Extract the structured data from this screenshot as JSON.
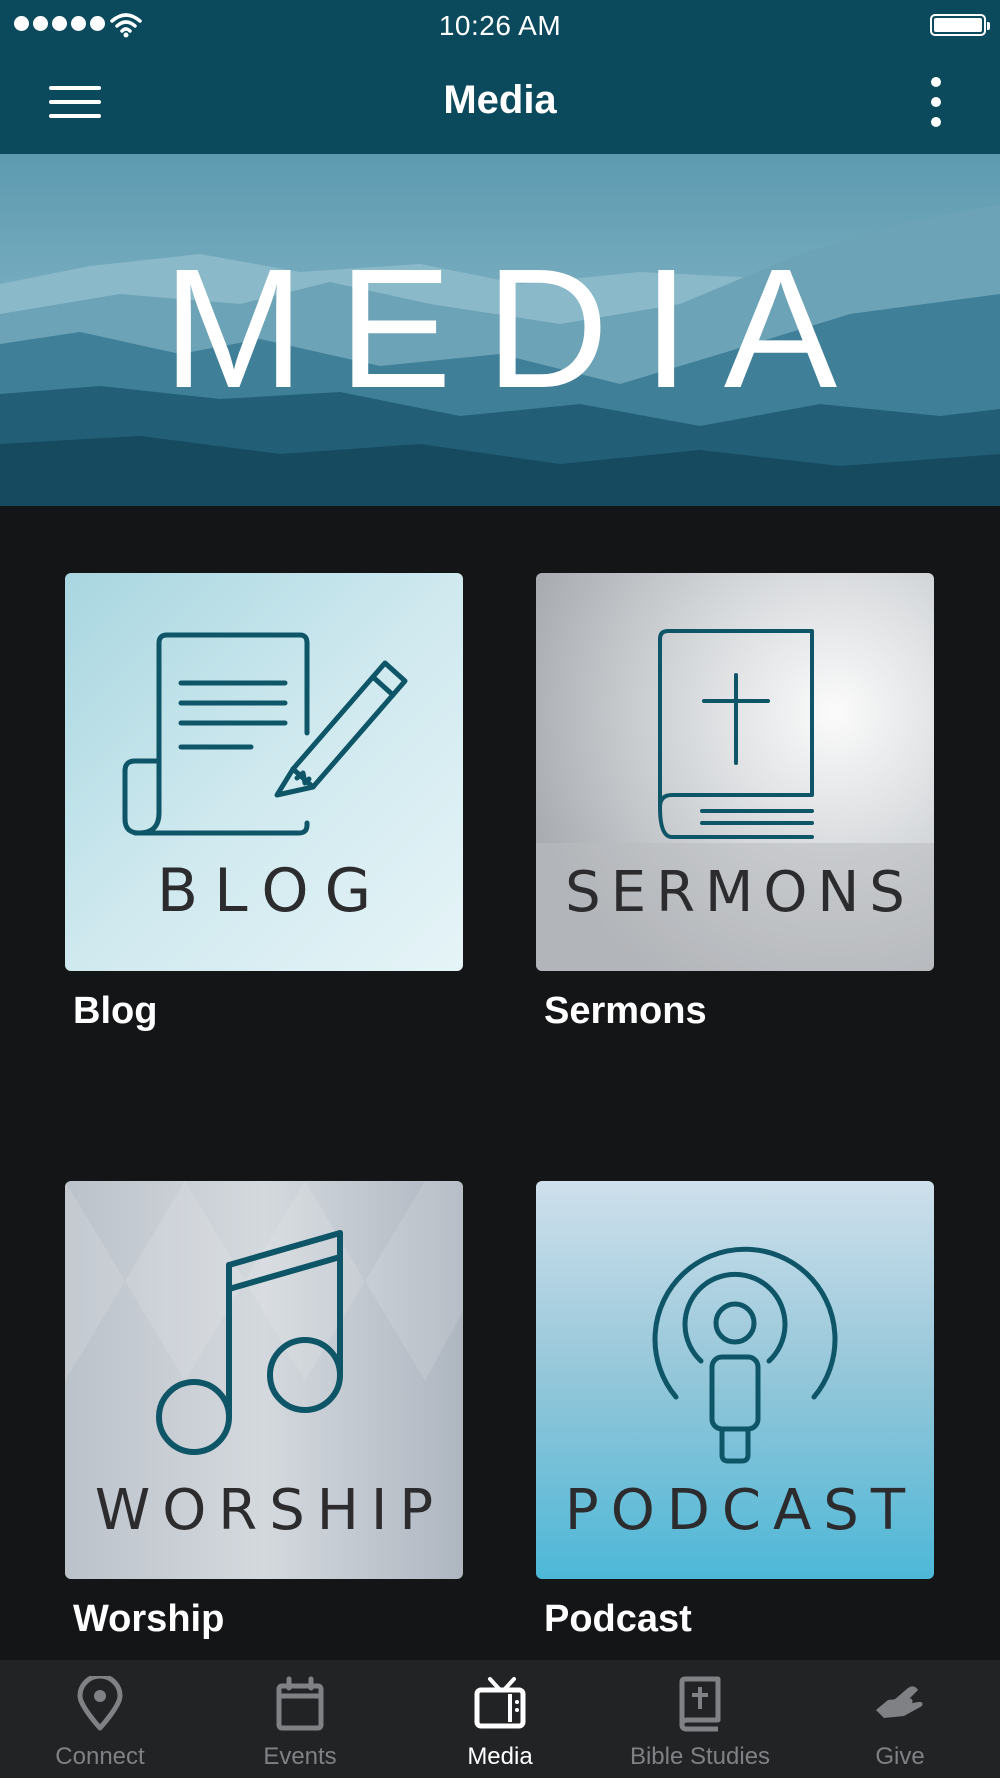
{
  "status_bar": {
    "time": "10:26 AM"
  },
  "app_bar": {
    "title": "Media"
  },
  "hero": {
    "text": "MEDIA"
  },
  "tiles": [
    {
      "caption": "BLOG",
      "label": "Blog",
      "icon": "document-pen-icon"
    },
    {
      "caption": "SERMONS",
      "label": "Sermons",
      "icon": "bible-cross-icon"
    },
    {
      "caption": "WORSHIP",
      "label": "Worship",
      "icon": "music-note-icon"
    },
    {
      "caption": "PODCAST",
      "label": "Podcast",
      "icon": "podcast-icon"
    }
  ],
  "tab_bar": {
    "active": "Media",
    "tabs": [
      {
        "label": "Connect",
        "icon": "location-pin-icon"
      },
      {
        "label": "Events",
        "icon": "calendar-icon"
      },
      {
        "label": "Media",
        "icon": "tv-icon"
      },
      {
        "label": "Bible Studies",
        "icon": "bible-icon"
      },
      {
        "label": "Give",
        "icon": "giving-hand-icon"
      }
    ]
  },
  "colors": {
    "header_bg": "#0b4a5c",
    "page_bg": "#141517",
    "tab_bar_bg": "#222325",
    "icon_stroke": "#0e5568",
    "tab_inactive": "#808185",
    "tab_active": "#ffffff"
  }
}
